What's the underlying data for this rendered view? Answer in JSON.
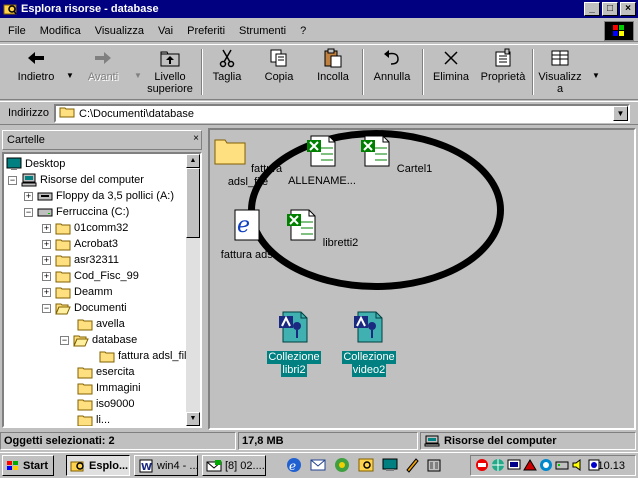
{
  "window": {
    "title": "Esplora risorse - database",
    "min": "_",
    "max": "□",
    "close": "×"
  },
  "menu": [
    "File",
    "Modifica",
    "Visualizza",
    "Vai",
    "Preferiti",
    "Strumenti",
    "?"
  ],
  "toolbar": {
    "indietro": "Indietro",
    "avanti": "Avanti",
    "livello1": "Livello",
    "livello2": "superiore",
    "taglia": "Taglia",
    "copia": "Copia",
    "incolla": "Incolla",
    "annulla": "Annulla",
    "elimina": "Elimina",
    "proprieta": "Proprietà",
    "visualizza1": "Visualizz",
    "visualizza2": "a"
  },
  "address": {
    "label": "Indirizzo",
    "value": "C:\\Documenti\\database"
  },
  "tree": {
    "header": "Cartelle",
    "close": "×",
    "nodes": [
      "Desktop",
      "Risorse del computer",
      "Floppy da 3,5 pollici (A:)",
      "Ferruccina (C:)",
      "01comm32",
      "Acrobat3",
      "asr32311",
      "Cod_Fisc_99",
      "Deamm",
      "Documenti",
      "avella",
      "database",
      "fattura adsl_file",
      "esercita",
      "Immagini",
      "iso9000",
      "li..."
    ]
  },
  "files": [
    {
      "name1": "fattura",
      "name2": "adsl_file"
    },
    {
      "name1": "ALLENAME...",
      "name2": ""
    },
    {
      "name1": "Cartel1",
      "name2": ""
    },
    {
      "name1": "fattura adsl",
      "name2": ""
    },
    {
      "name1": "libretti2",
      "name2": ""
    },
    {
      "name1": "Collezione",
      "name2": "libri2"
    },
    {
      "name1": "Collezione",
      "name2": "video2"
    }
  ],
  "status": {
    "selected": "Oggetti selezionati: 2",
    "size": "17,8 MB",
    "location": "Risorse del computer"
  },
  "taskbar": {
    "start": "Start",
    "tasks": [
      "Esplo...",
      "win4 - ...",
      "[8] 02...."
    ],
    "clock": "10.13"
  }
}
